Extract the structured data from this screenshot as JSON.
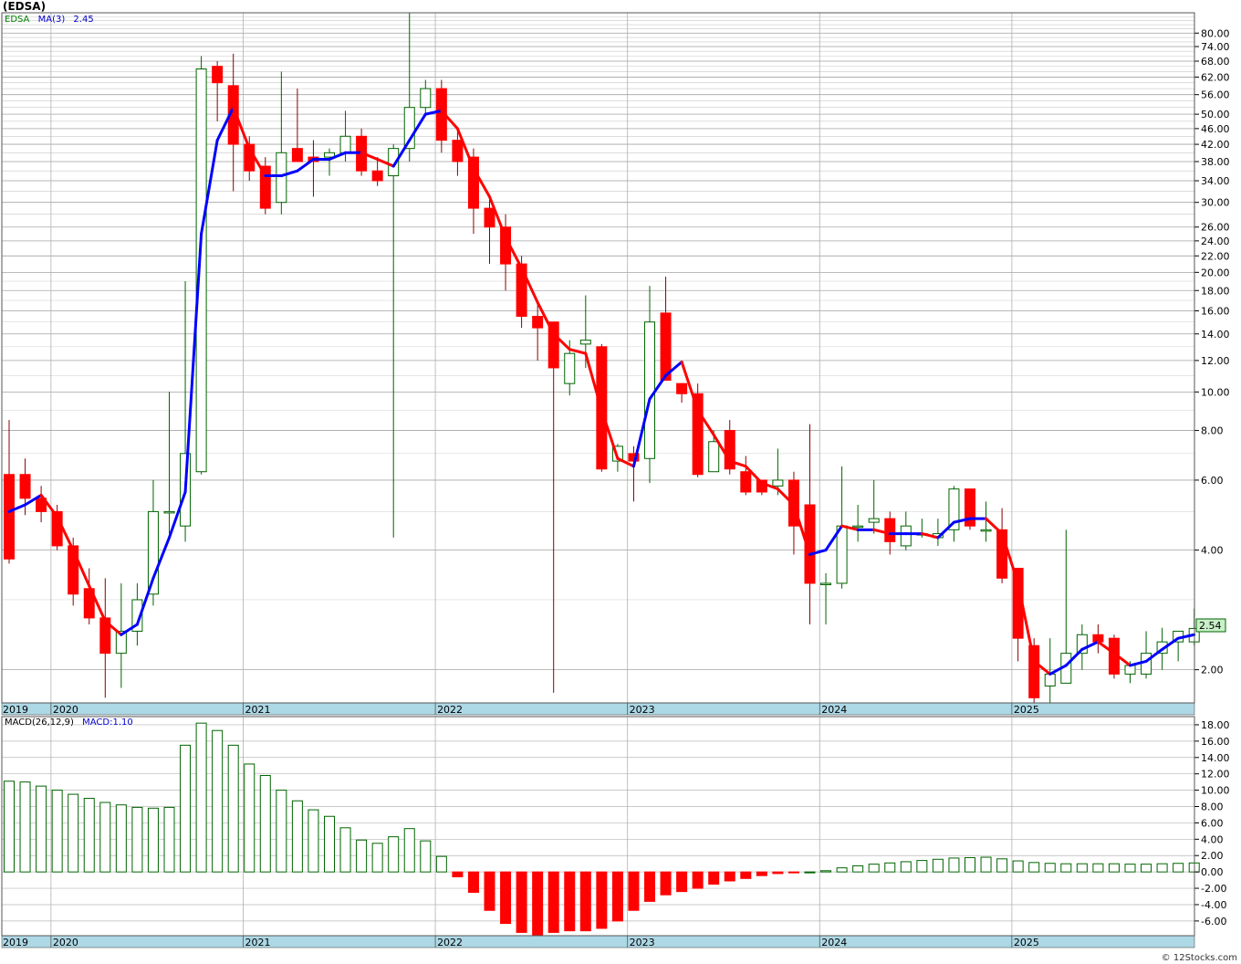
{
  "title": "(EDSA)",
  "legend": {
    "symbol": "EDSA",
    "ma_label": "MA(3)",
    "ma_value": "2.45"
  },
  "macd_legend": {
    "label": "MACD(26,12,9)",
    "value": "MACD:1.10"
  },
  "watermark": "© 12Stocks.com",
  "last_price_tag": "2.54",
  "colors": {
    "up": "#006400",
    "down": "#ff0000",
    "ma_up": "#0000ff",
    "ma_down": "#ff0000",
    "axis_band": "#add8e6",
    "grid": "#999999"
  },
  "chart_data": [
    {
      "type": "candlestick",
      "title": "(EDSA)",
      "scale": "log",
      "ylim": [
        1.65,
        90
      ],
      "y_ticks": [
        "80.00",
        "74.00",
        "68.00",
        "62.00",
        "56.00",
        "50.00",
        "46.00",
        "42.00",
        "38.00",
        "34.00",
        "30.00",
        "26.00",
        "24.00",
        "22.00",
        "20.00",
        "18.00",
        "16.00",
        "14.00",
        "12.00",
        "10.00",
        "8.00",
        "6.00",
        "4.00",
        "2.00"
      ],
      "year_labels": [
        "2019",
        "2020",
        "2021",
        "2022",
        "2023",
        "2024",
        "2025"
      ],
      "x_start": "2019-10",
      "interval": "monthly",
      "candles": [
        [
          6.2,
          8.5,
          3.7,
          3.8
        ],
        [
          6.2,
          6.8,
          4.9,
          5.4
        ],
        [
          5.4,
          5.8,
          4.7,
          5.0
        ],
        [
          5.0,
          5.2,
          4.0,
          4.1
        ],
        [
          4.1,
          4.3,
          2.9,
          3.1
        ],
        [
          3.2,
          3.6,
          2.6,
          2.7
        ],
        [
          2.7,
          3.4,
          1.7,
          2.2
        ],
        [
          2.2,
          3.3,
          1.8,
          2.5
        ],
        [
          2.5,
          3.3,
          2.3,
          3.0
        ],
        [
          3.1,
          6.0,
          2.9,
          5.0
        ],
        [
          5.0,
          10.0,
          4.4,
          5.0
        ],
        [
          4.6,
          19.0,
          4.2,
          7.0
        ],
        [
          6.3,
          70.0,
          6.2,
          65.0
        ],
        [
          66.0,
          68.0,
          48.0,
          60.0
        ],
        [
          59.0,
          71.0,
          32.0,
          42.0
        ],
        [
          42.0,
          44.0,
          34.0,
          36.0
        ],
        [
          37.0,
          39.0,
          28.0,
          29.0
        ],
        [
          30.0,
          64.0,
          28.0,
          40.0
        ],
        [
          41.0,
          58.0,
          38.0,
          38.0
        ],
        [
          39.0,
          43.0,
          31.0,
          38.0
        ],
        [
          39.0,
          41.0,
          35.0,
          40.0
        ],
        [
          40.0,
          51.0,
          38.0,
          44.0
        ],
        [
          44.0,
          46.0,
          35.0,
          36.0
        ],
        [
          36.0,
          39.0,
          33.0,
          34.0
        ],
        [
          35.0,
          42.0,
          4.3,
          41.0
        ],
        [
          41.0,
          95.0,
          38.0,
          52.0
        ],
        [
          52.0,
          61.0,
          50.0,
          58.0
        ],
        [
          58.0,
          61.0,
          40.0,
          43.0
        ],
        [
          43.0,
          46.0,
          35.0,
          38.0
        ],
        [
          39.0,
          41.0,
          25.0,
          29.0
        ],
        [
          29.0,
          31.0,
          21.0,
          26.0
        ],
        [
          26.0,
          28.0,
          18.0,
          21.0
        ],
        [
          21.0,
          22.0,
          14.5,
          15.5
        ],
        [
          15.5,
          17.0,
          12.0,
          14.5
        ],
        [
          15.0,
          15.0,
          1.75,
          11.5
        ],
        [
          10.5,
          13.5,
          9.8,
          12.5
        ],
        [
          13.2,
          17.5,
          11.5,
          13.5
        ],
        [
          13.0,
          13.2,
          6.3,
          6.4
        ],
        [
          6.7,
          7.4,
          6.3,
          7.3
        ],
        [
          7.0,
          7.3,
          5.3,
          6.7
        ],
        [
          6.8,
          18.5,
          5.9,
          15.0
        ],
        [
          15.8,
          19.5,
          10.7,
          10.7
        ],
        [
          10.5,
          10.5,
          9.4,
          9.9
        ],
        [
          9.9,
          10.5,
          6.1,
          6.2
        ],
        [
          6.3,
          8.0,
          6.3,
          7.5
        ],
        [
          8.0,
          8.5,
          6.2,
          6.4
        ],
        [
          6.3,
          6.9,
          5.5,
          5.6
        ],
        [
          6.0,
          6.0,
          5.5,
          5.6
        ],
        [
          5.8,
          7.2,
          5.5,
          6.0
        ],
        [
          6.0,
          6.3,
          3.9,
          4.6
        ],
        [
          5.2,
          8.3,
          2.6,
          3.3
        ],
        [
          3.3,
          3.5,
          2.6,
          3.3
        ],
        [
          3.3,
          6.5,
          3.2,
          4.6
        ],
        [
          4.6,
          5.2,
          4.2,
          4.6
        ],
        [
          4.7,
          6.0,
          4.4,
          4.8
        ],
        [
          4.8,
          5.0,
          3.9,
          4.2
        ],
        [
          4.1,
          5.0,
          4.0,
          4.6
        ],
        [
          4.4,
          4.8,
          4.3,
          4.4
        ],
        [
          4.3,
          4.8,
          4.1,
          4.4
        ],
        [
          4.5,
          5.8,
          4.2,
          5.7
        ],
        [
          5.7,
          5.7,
          4.5,
          4.6
        ],
        [
          4.5,
          5.3,
          4.2,
          4.5
        ],
        [
          4.5,
          5.1,
          3.3,
          3.4
        ],
        [
          3.6,
          3.6,
          2.1,
          2.4
        ],
        [
          2.3,
          2.4,
          1.6,
          1.7
        ],
        [
          1.82,
          2.4,
          1.6,
          1.95
        ],
        [
          1.85,
          4.5,
          1.85,
          2.2
        ],
        [
          2.2,
          2.6,
          2.0,
          2.45
        ],
        [
          2.45,
          2.6,
          2.2,
          2.35
        ],
        [
          2.4,
          2.45,
          1.9,
          1.95
        ],
        [
          1.95,
          2.1,
          1.85,
          2.05
        ],
        [
          1.95,
          2.5,
          1.9,
          2.2
        ],
        [
          2.2,
          2.55,
          2.0,
          2.35
        ],
        [
          2.35,
          2.5,
          2.1,
          2.5
        ],
        [
          2.35,
          2.85,
          2.3,
          2.54
        ]
      ],
      "ma3": [
        5.0,
        5.2,
        5.5,
        4.85,
        4.0,
        3.25,
        2.65,
        2.45,
        2.6,
        3.4,
        4.3,
        5.6,
        25.0,
        43.0,
        52.0,
        41.0,
        35.0,
        35.0,
        36.0,
        38.5,
        38.5,
        40.0,
        40.0,
        38.5,
        37.0,
        43.0,
        50.0,
        51.0,
        46.0,
        36.5,
        31.0,
        24.5,
        20.5,
        16.8,
        14.0,
        12.8,
        12.5,
        9.0,
        6.8,
        6.5,
        9.6,
        11.0,
        11.9,
        9.0,
        7.8,
        6.7,
        6.5,
        5.9,
        5.7,
        5.2,
        3.9,
        4.0,
        4.6,
        4.5,
        4.5,
        4.4,
        4.4,
        4.4,
        4.3,
        4.7,
        4.8,
        4.8,
        4.4,
        3.3,
        2.1,
        1.95,
        2.05,
        2.25,
        2.35,
        2.2,
        2.05,
        2.1,
        2.25,
        2.4,
        2.45
      ],
      "macd": [
        11.1,
        11.0,
        10.5,
        10.0,
        9.5,
        9.0,
        8.5,
        8.2,
        7.9,
        7.8,
        7.9,
        15.5,
        18.2,
        17.3,
        15.5,
        13.2,
        11.8,
        10.0,
        8.7,
        7.6,
        6.8,
        5.4,
        3.9,
        3.5,
        4.3,
        5.3,
        3.8,
        1.9,
        -0.6,
        -2.5,
        -4.7,
        -6.3,
        -7.4,
        -7.7,
        -7.4,
        -7.2,
        -7.2,
        -6.9,
        -6.0,
        -4.7,
        -3.6,
        -2.8,
        -2.4,
        -2.0,
        -1.5,
        -1.1,
        -0.8,
        -0.45,
        -0.2,
        -0.1,
        0.0,
        0.15,
        0.5,
        0.75,
        0.95,
        1.1,
        1.25,
        1.4,
        1.55,
        1.7,
        1.75,
        1.8,
        1.6,
        1.35,
        1.15,
        1.05,
        1.0,
        1.0,
        1.0,
        1.0,
        0.95,
        0.95,
        1.0,
        1.05,
        1.1
      ],
      "macd_ylim": [
        -7.8,
        19
      ],
      "macd_ticks": [
        "18.00",
        "16.00",
        "14.00",
        "12.00",
        "10.00",
        "8.00",
        "6.00",
        "4.00",
        "2.00",
        "0.00",
        "-2.00",
        "-4.00",
        "-6.00"
      ]
    }
  ]
}
